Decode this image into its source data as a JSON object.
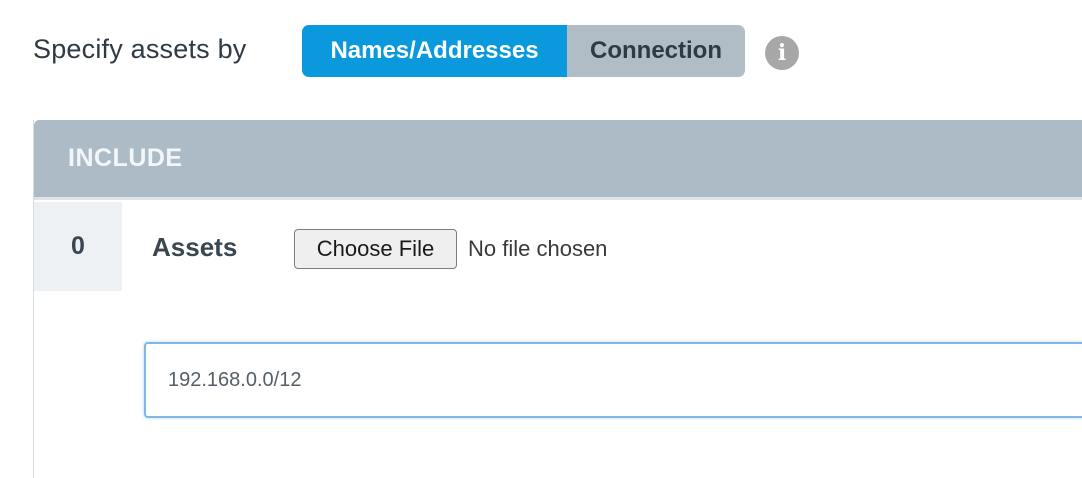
{
  "specify": {
    "label": "Specify assets by",
    "options": [
      "Names/Addresses",
      "Connection"
    ],
    "selected": "Names/Addresses",
    "info_icon_glyph": "i",
    "active_color": "#0a99dc",
    "inactive_color": "#b0bdc7"
  },
  "include": {
    "header": "INCLUDE",
    "header_color": "#adbbc6",
    "count": "0",
    "assets_label": "Assets",
    "file_button_label": "Choose File",
    "file_status": "No file chosen",
    "input_value": "192.168.0.0/12"
  }
}
